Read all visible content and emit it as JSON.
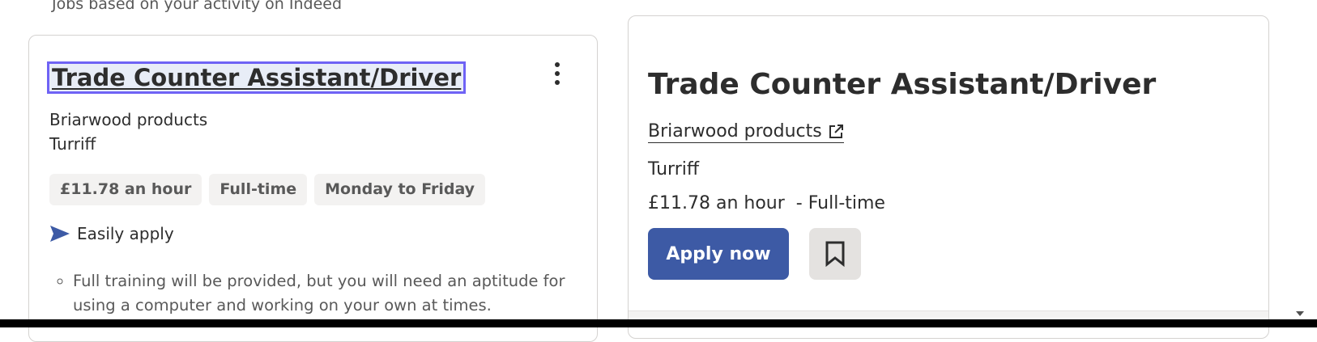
{
  "section_caption": "Jobs based on your activity on Indeed",
  "job_card": {
    "title": "Trade Counter Assistant/Driver",
    "company": "Briarwood products",
    "location": "Turriff",
    "tags": [
      "£11.78 an hour",
      "Full-time",
      "Monday to Friday"
    ],
    "apply_label": "Easily apply",
    "apply_icon": "send-icon",
    "more_icon": "kebab-menu-icon",
    "snippet": "Full training will be provided, but you will need an aptitude for using a computer and working on your own at times."
  },
  "detail_panel": {
    "title": "Trade Counter Assistant/Driver",
    "company": "Briarwood products",
    "company_icon": "external-link-icon",
    "location": "Turriff",
    "salary_type": "£11.78 an hour  - Full-time",
    "apply_label": "Apply now",
    "save_icon": "bookmark-icon"
  },
  "colors": {
    "accent": "#3d5aa5",
    "focus_outline": "#6f63f5",
    "tag_background": "#f3f2f1",
    "text": "#2d2d2d"
  }
}
